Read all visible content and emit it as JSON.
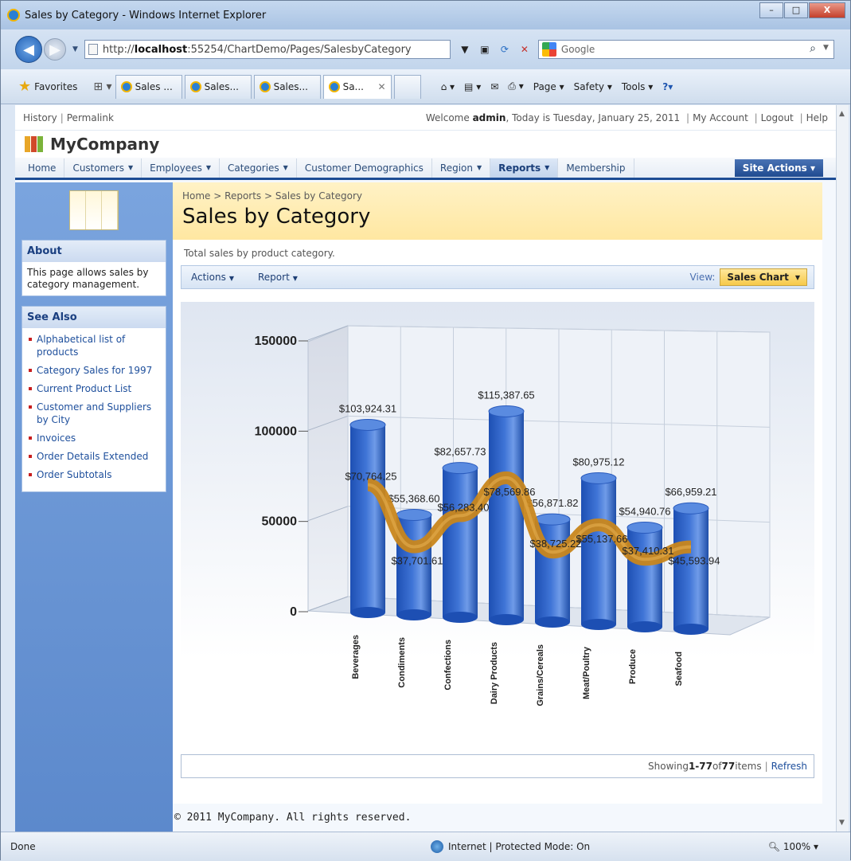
{
  "window": {
    "title": "Sales by Category - Windows Internet Explorer",
    "min": "–",
    "max": "□",
    "close": "X"
  },
  "address": {
    "prefix": "http://",
    "host": "localhost",
    "rest": ":55254/ChartDemo/Pages/SalesbyCategory",
    "search_placeholder": "Google"
  },
  "favorites": {
    "label": "Favorites"
  },
  "tabs": [
    {
      "label": "Sales ..."
    },
    {
      "label": "Sales..."
    },
    {
      "label": "Sales..."
    },
    {
      "label": "Sa..."
    }
  ],
  "commandbar": {
    "page": "Page ▾",
    "safety": "Safety ▾",
    "tools": "Tools ▾"
  },
  "utility": {
    "history": "History",
    "permalink": "Permalink",
    "welcome_pre": "Welcome ",
    "user": "admin",
    "welcome_post": ", Today is Tuesday, January 25, 2011",
    "my_account": "My Account",
    "logout": "Logout",
    "help": "Help"
  },
  "company": "MyCompany",
  "menu": [
    {
      "label": "Home",
      "arrow": false
    },
    {
      "label": "Customers",
      "arrow": true
    },
    {
      "label": "Employees",
      "arrow": true
    },
    {
      "label": "Categories",
      "arrow": true
    },
    {
      "label": "Customer Demographics",
      "arrow": false
    },
    {
      "label": "Region",
      "arrow": true
    },
    {
      "label": "Reports",
      "arrow": true
    },
    {
      "label": "Membership",
      "arrow": false
    }
  ],
  "site_actions": "Site Actions ▾",
  "sidebar": {
    "about_title": "About",
    "about_text": "This page allows sales by category management.",
    "see_also_title": "See Also",
    "links": [
      "Alphabetical list of products",
      "Category Sales for 1997",
      "Current Product List",
      "Customer and Suppliers by City",
      "Invoices",
      "Order Details Extended",
      "Order Subtotals"
    ]
  },
  "breadcrumb": {
    "home": "Home",
    "reports": "Reports",
    "current": "Sales by Category",
    "sep": ">"
  },
  "page_title": "Sales by Category",
  "description": "Total sales by product category.",
  "actionbar": {
    "actions": "Actions",
    "report": "Report",
    "view_label": "View:",
    "view_value": "Sales Chart"
  },
  "chart_data": {
    "type": "bar",
    "categories": [
      "Beverages",
      "Condiments",
      "Confections",
      "Dairy Products",
      "Grains/Cereals",
      "Meat/Poultry",
      "Produce",
      "Seafood"
    ],
    "series": [
      {
        "values": [
          103924.31,
          55368.6,
          82657.73,
          115387.65,
          56871.82,
          80975.12,
          54940.76,
          66959.21
        ],
        "labels": [
          "$103,924.31",
          "$55,368.60",
          "$82,657.73",
          "$115,387.65",
          "$56,871.82",
          "$80,975.12",
          "$54,940.76",
          "$66,959.21"
        ]
      },
      {
        "values": [
          70764.25,
          37701.61,
          56283.4,
          78569.86,
          38725.22,
          55137.66,
          37410.31,
          45593.94
        ],
        "labels": [
          "$70,764.25",
          "$37,701.61",
          "$56,283.40",
          "$78,569.86",
          "$38,725.22",
          "$55,137.66",
          "$37,410.31",
          "$45,593.94"
        ]
      }
    ],
    "yticks": [
      "150000",
      "100000",
      "50000",
      "0"
    ],
    "ylim": [
      0,
      150000
    ],
    "colors": {
      "bar": "#3f74d6",
      "line": "#c8861c"
    }
  },
  "pager": {
    "showing": "Showing ",
    "range": "1-77",
    "of": " of ",
    "total": "77",
    "items": " items",
    "refresh": "Refresh"
  },
  "footer": "© 2011 MyCompany. All rights reserved.",
  "status": {
    "left": "Done",
    "zone": "Internet | Protected Mode: On",
    "zoom": "100%"
  }
}
